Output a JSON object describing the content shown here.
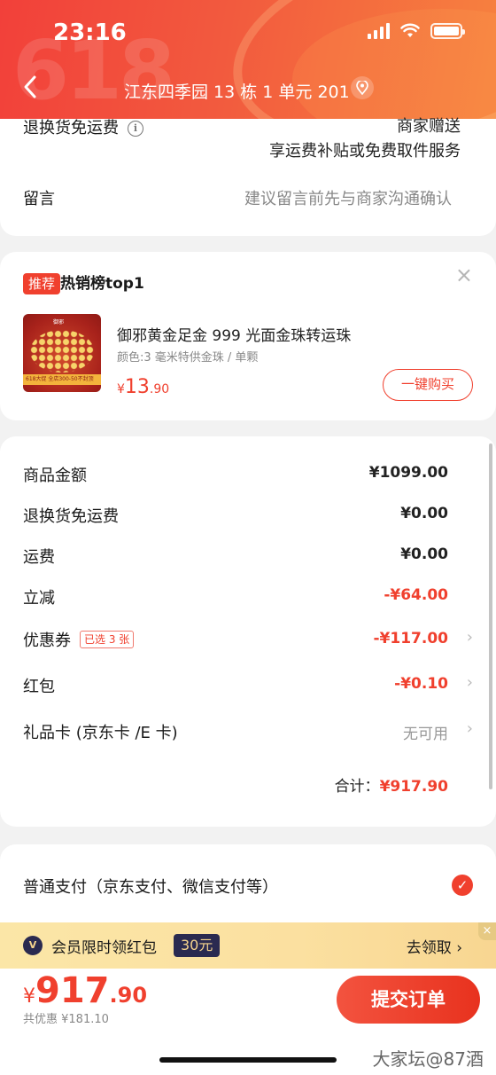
{
  "status_bar": {
    "time": "23:16"
  },
  "header": {
    "address": "江东四季园 13 栋 1 单元 201",
    "deco_text": "618"
  },
  "top_section": {
    "return_free_label": "退换货免运费",
    "return_free_value_line1": "商家赠送",
    "return_free_value_line2": "享运费补贴或免费取件服务",
    "message_label": "留言",
    "message_placeholder": "建议留言前先与商家沟通确认"
  },
  "recommend": {
    "tag": "推荐",
    "title": "热销榜top1",
    "product_title": "御邪黄金足金 999 光面金珠转运珠",
    "product_spec": "颜色:3 毫米特供金珠 / 单颗",
    "price_symbol": "¥",
    "price_int": "13",
    "price_dec": ".90",
    "buy_label": "一键购买",
    "img_brand": "御邪",
    "img_banner": "618大促 全店300-50不封顶"
  },
  "summary": {
    "rows": [
      {
        "label": "商品金额",
        "value": "¥1099.00"
      },
      {
        "label": "退换货免运费",
        "value": "¥0.00"
      },
      {
        "label": "运费",
        "value": "¥0.00"
      },
      {
        "label": "立减",
        "value": "-¥64.00"
      },
      {
        "label": "优惠券",
        "badge": "已选 3 张",
        "value": "-¥117.00"
      },
      {
        "label": "红包",
        "value": "-¥0.10"
      },
      {
        "label": "礼品卡 (京东卡 /E 卡)",
        "value": "无可用"
      }
    ],
    "total_label": "合计：",
    "total_value": "¥917.90"
  },
  "payment": {
    "method": "普通支付（京东支付、微信支付等）"
  },
  "member_banner": {
    "icon_text": "V",
    "text": "会员限时领红包",
    "badge": "30元",
    "action": "去领取 ›",
    "close": "×"
  },
  "bottom_bar": {
    "price_symbol": "¥",
    "price_int": "917",
    "price_dec": ".90",
    "saved": "共优惠 ¥181.10",
    "submit_label": "提交订单",
    "watermark": "大家坛@87酒"
  },
  "colors": {
    "accent": "#f0402e",
    "header_start": "#f2403a",
    "header_end": "#f7823f",
    "banner": "#fbe6a7"
  }
}
